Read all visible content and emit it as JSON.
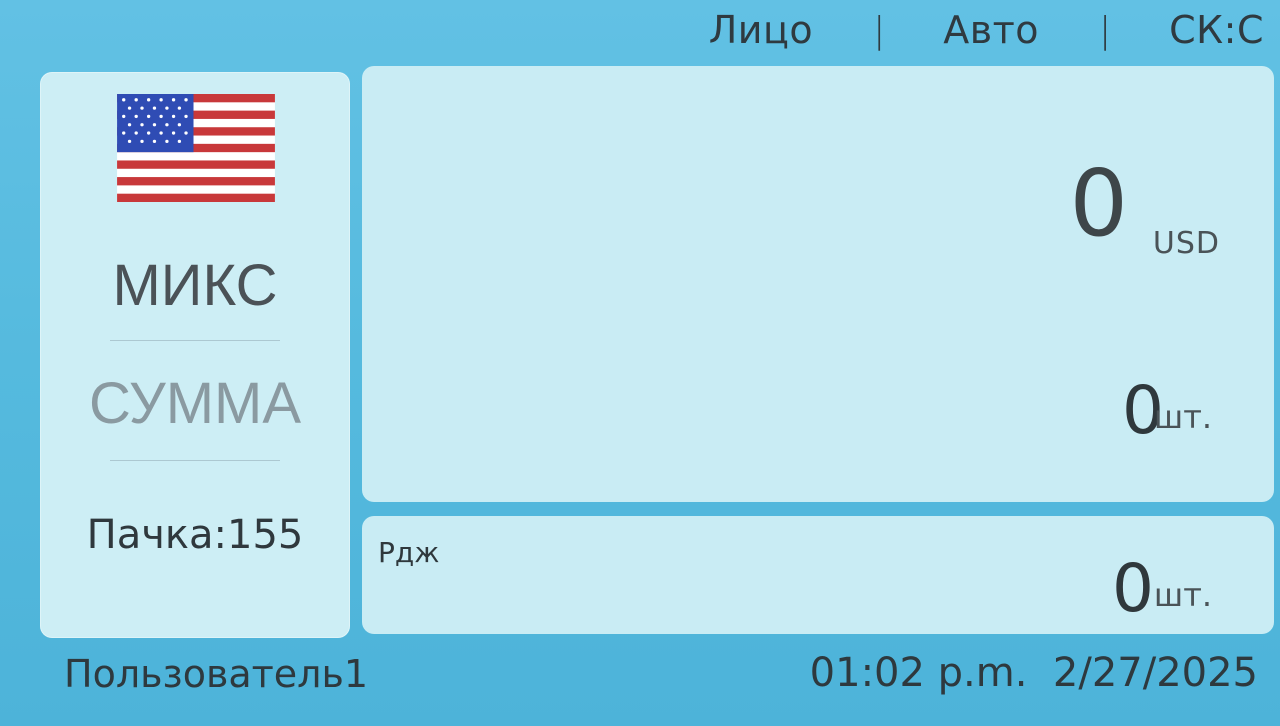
{
  "topbar": {
    "side": "Лицо",
    "mode": "Авто",
    "speed": "СК:С"
  },
  "left_panel": {
    "flag_icon": "us-flag-icon",
    "count_mode": "МИКС",
    "sum_mode": "СУММА",
    "batch": "Пачка:155"
  },
  "main": {
    "amount": "0",
    "currency": "USD",
    "pieces": "0",
    "pieces_unit": "шт."
  },
  "reject": {
    "label": "Рдж",
    "pieces": "0",
    "pieces_unit": "шт."
  },
  "status": {
    "user": "Пользователь1",
    "time": "01:02 p.m.",
    "date": "2/27/2025"
  },
  "colors": {
    "background": "#55bade",
    "panel": "#c9ecf4",
    "text": "#2f383c"
  }
}
